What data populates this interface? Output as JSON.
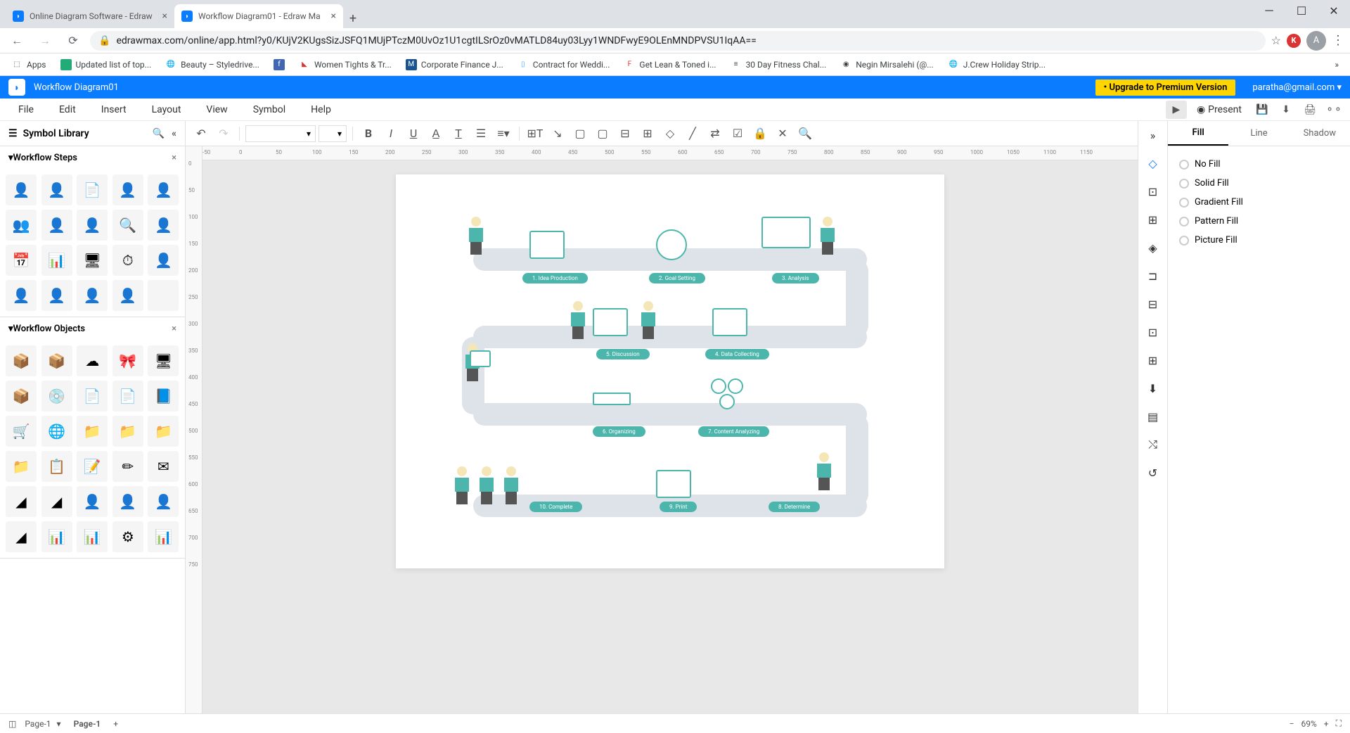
{
  "browser": {
    "tabs": [
      {
        "title": "Online Diagram Software - Edraw",
        "active": false
      },
      {
        "title": "Workflow Diagram01 - Edraw Ma",
        "active": true
      }
    ],
    "url": "edrawmax.com/online/app.html?y0/KUjV2KUgsSizJSFQ1MUjPTczM0UvOz1U1cgtILSrOz0vMATLD84uy03Lyy1WNDFwyE9OLEnMNDPVSU1IqAA=="
  },
  "bookmarks": [
    {
      "label": "Apps"
    },
    {
      "label": "Updated list of top..."
    },
    {
      "label": "Beauty – Styledrive..."
    },
    {
      "label": ""
    },
    {
      "label": "Women Tights & Tr..."
    },
    {
      "label": "Corporate Finance J..."
    },
    {
      "label": "Contract for Weddi..."
    },
    {
      "label": "Get Lean & Toned i..."
    },
    {
      "label": "30 Day Fitness Chal..."
    },
    {
      "label": "Negin Mirsalehi (@..."
    },
    {
      "label": "J.Crew Holiday Strip..."
    }
  ],
  "app": {
    "doc_title": "Workflow Diagram01",
    "upgrade": "• Upgrade to Premium Version",
    "user": "paratha@gmail.com"
  },
  "menus": [
    "File",
    "Edit",
    "Insert",
    "Layout",
    "View",
    "Symbol",
    "Help"
  ],
  "present": "Present",
  "sidebar": {
    "title": "Symbol Library",
    "sections": [
      {
        "title": "Workflow Steps"
      },
      {
        "title": "Workflow Objects"
      }
    ]
  },
  "diagram": {
    "steps": [
      {
        "label": "1. Idea Production"
      },
      {
        "label": "2. Goal Setting"
      },
      {
        "label": "3. Analysis"
      },
      {
        "label": "4. Data Collecting"
      },
      {
        "label": "5. Discussion"
      },
      {
        "label": "6. Organizing"
      },
      {
        "label": "7. Content Analyzing"
      },
      {
        "label": "8. Determine"
      },
      {
        "label": "9. Print"
      },
      {
        "label": "10. Complete"
      }
    ]
  },
  "props": {
    "tabs": [
      "Fill",
      "Line",
      "Shadow"
    ],
    "fill_options": [
      "No Fill",
      "Solid Fill",
      "Gradient Fill",
      "Pattern Fill",
      "Picture Fill"
    ]
  },
  "status": {
    "page_selector": "Page-1",
    "page_tab": "Page-1",
    "zoom": "69%"
  },
  "ruler_h": [
    "-50",
    "0",
    "50",
    "100",
    "150",
    "200",
    "250",
    "300",
    "350",
    "400",
    "450",
    "500",
    "550",
    "600",
    "650",
    "700",
    "750",
    "800",
    "850",
    "900",
    "950",
    "1000",
    "1050",
    "1100",
    "1150"
  ],
  "ruler_v": [
    "0",
    "50",
    "100",
    "150",
    "200",
    "250",
    "300",
    "350",
    "400",
    "450",
    "500",
    "550",
    "600",
    "650",
    "700",
    "750"
  ]
}
